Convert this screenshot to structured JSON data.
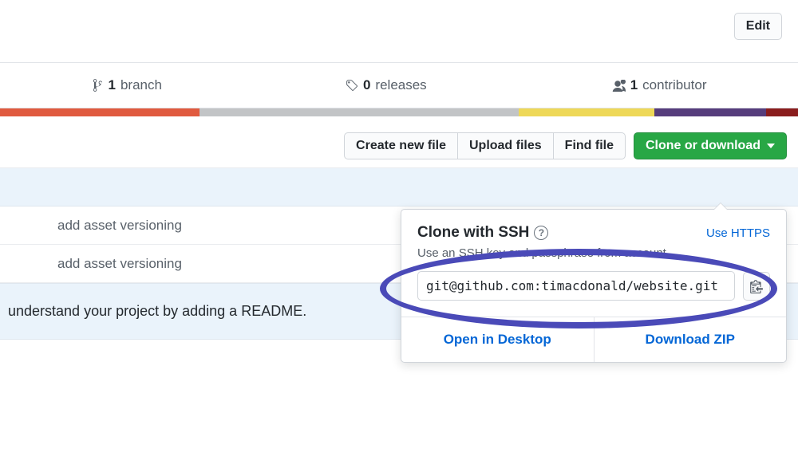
{
  "edit_button": "Edit",
  "stats": {
    "branches": {
      "count": "1",
      "label": "branch"
    },
    "releases": {
      "count": "0",
      "label": "releases"
    },
    "contributors": {
      "count": "1",
      "label": "contributor"
    }
  },
  "language_bar": [
    {
      "color": "#e05a3f",
      "pct": 25
    },
    {
      "color": "#c2c4c6",
      "pct": 40
    },
    {
      "color": "#eed858",
      "pct": 17
    },
    {
      "color": "#563d7c",
      "pct": 14
    },
    {
      "color": "#8a1d1d",
      "pct": 4
    }
  ],
  "toolbar": {
    "create_file": "Create new file",
    "upload_files": "Upload files",
    "find_file": "Find file",
    "clone": "Clone or download"
  },
  "commits": [
    {
      "message": "add asset versioning"
    },
    {
      "message": "add asset versioning"
    }
  ],
  "readme_prompt": "understand your project by adding a README.",
  "clone_popup": {
    "title": "Clone with SSH",
    "switch_link": "Use HTTPS",
    "description": "Use an SSH key and passphrase from account.",
    "url": "git@github.com:timacdonald/website.git",
    "open_desktop": "Open in Desktop",
    "download_zip": "Download ZIP"
  }
}
